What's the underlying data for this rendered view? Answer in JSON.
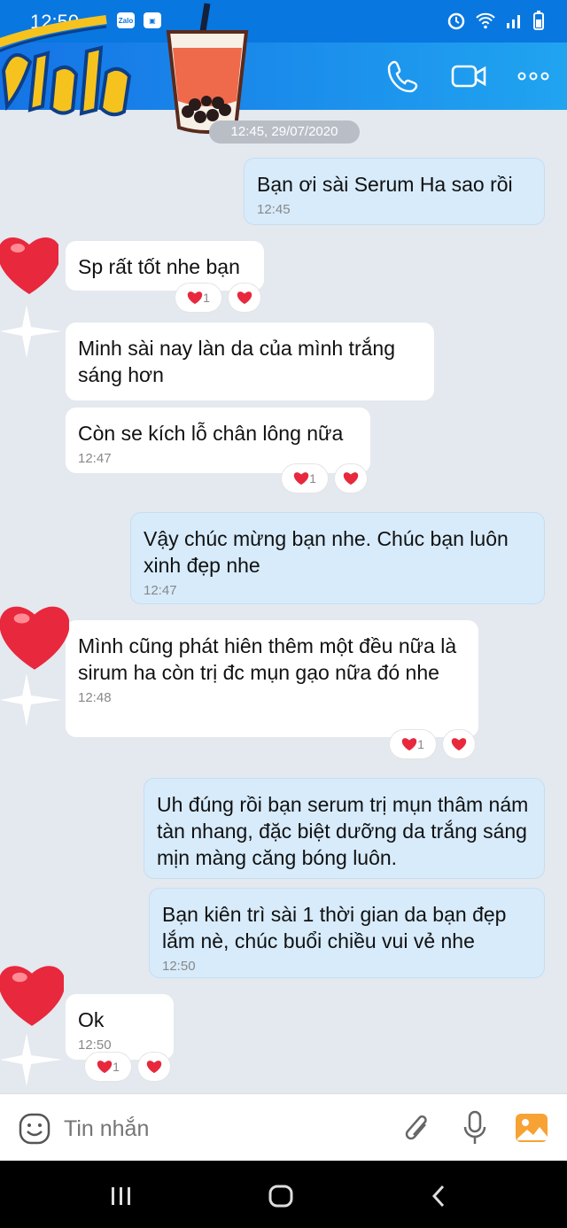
{
  "status_bar": {
    "time": "12:50",
    "app_badge": "Zalo"
  },
  "date_separator": "12:45, 29/07/2020",
  "messages": [
    {
      "dir": "out",
      "text": "Bạn ơi sài Serum Ha sao rồi",
      "time": "12:45"
    },
    {
      "dir": "in",
      "text": "Sp rất tốt nhe bạn",
      "time": "",
      "reaction_count": "1"
    },
    {
      "dir": "in",
      "text": "Minh sài nay làn da của mình trắng sáng hơn",
      "time": ""
    },
    {
      "dir": "in",
      "text": "Còn se kích lỗ chân lông nữa",
      "time": "12:47",
      "reaction_count": "1"
    },
    {
      "dir": "out",
      "text": "Vậy chúc mừng bạn nhe. Chúc bạn luôn xinh đẹp nhe",
      "time": "12:47"
    },
    {
      "dir": "in",
      "text": "Mình cũng phát hiên thêm một đều nữa là sirum ha còn trị đc mụn gạo nữa đó nhe",
      "time": "12:48",
      "reaction_count": "1"
    },
    {
      "dir": "out",
      "text": "Uh đúng rồi bạn serum trị mụn thâm nám tàn nhang, đặc biệt dưỡng da trắng sáng mịn màng căng bóng luôn.",
      "time": ""
    },
    {
      "dir": "out",
      "text": "Bạn kiên trì sài 1 thời gian da bạn đẹp lắm nè, chúc buổi chiều vui vẻ nhe",
      "time": "12:50"
    },
    {
      "dir": "in",
      "text": "Ok",
      "time": "12:50",
      "reaction_count": "1"
    }
  ],
  "input": {
    "placeholder": "Tin nhắn"
  },
  "colors": {
    "header": "#1574e6",
    "out_bubble": "#d7ebfb",
    "in_bubble": "#ffffff",
    "heart": "#e8283c"
  }
}
